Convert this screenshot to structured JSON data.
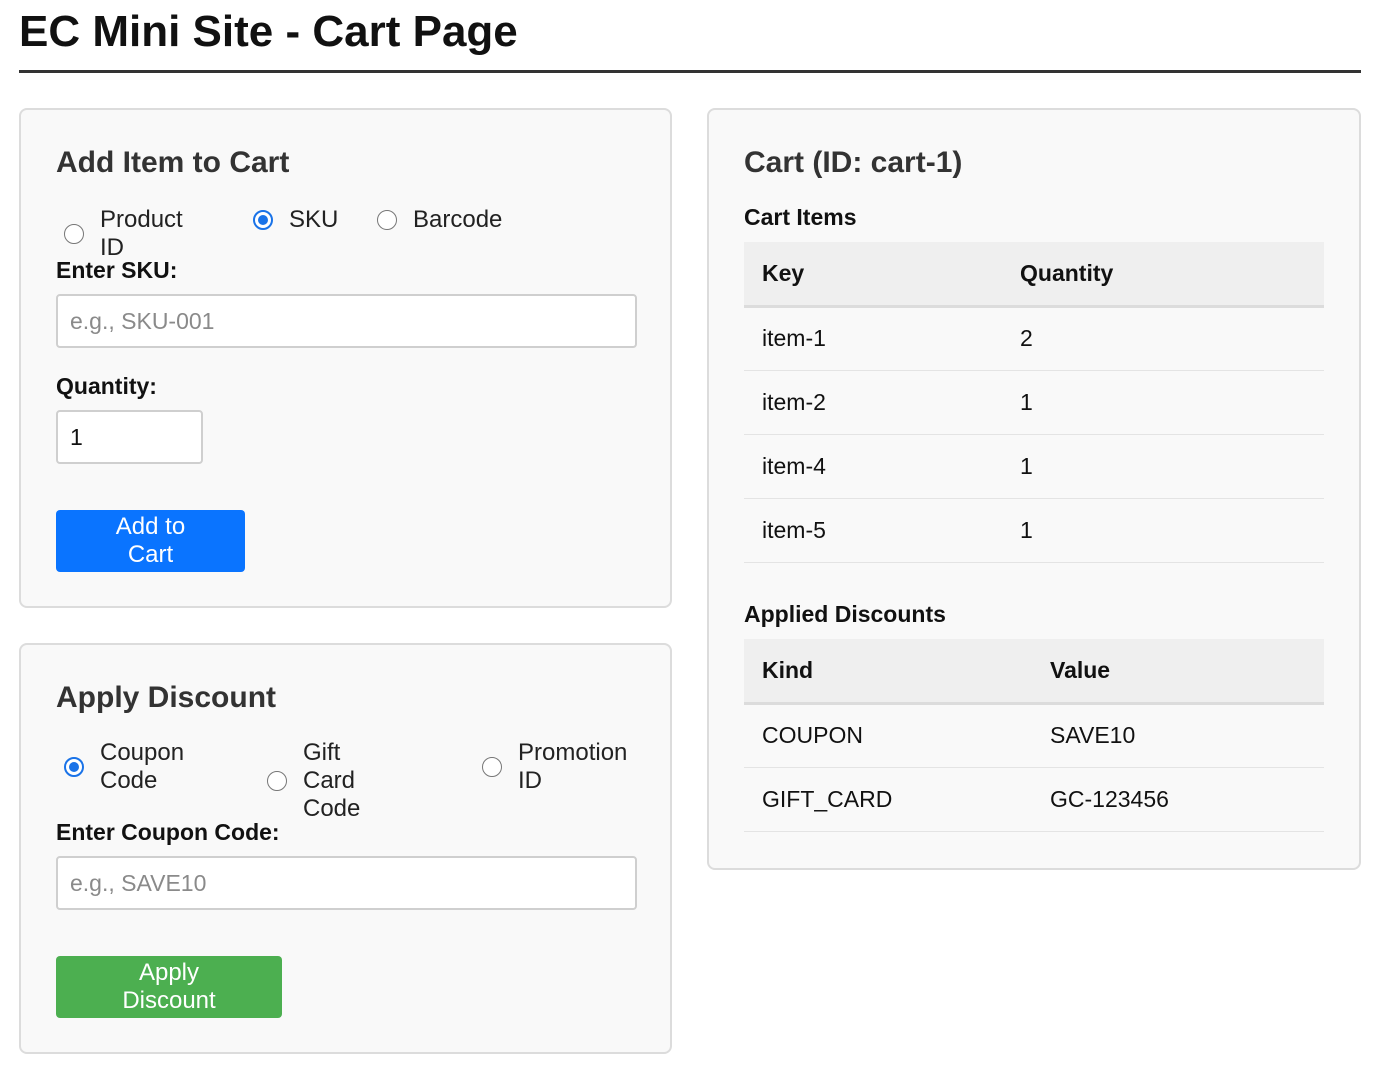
{
  "page": {
    "title": "EC Mini Site - Cart Page"
  },
  "add_item": {
    "heading": "Add Item to Cart",
    "id_types": [
      {
        "label": "Product ID",
        "checked": false
      },
      {
        "label": "SKU",
        "checked": true
      },
      {
        "label": "Barcode",
        "checked": false
      }
    ],
    "sku_label": "Enter SKU:",
    "sku_placeholder": "e.g., SKU-001",
    "sku_value": "",
    "quantity_label": "Quantity:",
    "quantity_value": "1",
    "button_label": "Add to Cart"
  },
  "discount": {
    "heading": "Apply Discount",
    "types": [
      {
        "label_line1": "Coupon",
        "label_line2": "Code",
        "checked": true
      },
      {
        "label_line1": "Gift Card",
        "label_line2": "Code",
        "checked": false
      },
      {
        "label_line1": "Promotion",
        "label_line2": "ID",
        "checked": false
      }
    ],
    "code_label": "Enter Coupon Code:",
    "code_placeholder": "e.g., SAVE10",
    "code_value": "",
    "button_label": "Apply Discount"
  },
  "cart": {
    "heading": "Cart (ID: cart-1)",
    "items_heading": "Cart Items",
    "items_columns": [
      "Key",
      "Quantity"
    ],
    "items": [
      {
        "key": "item-1",
        "quantity": "2"
      },
      {
        "key": "item-2",
        "quantity": "1"
      },
      {
        "key": "item-4",
        "quantity": "1"
      },
      {
        "key": "item-5",
        "quantity": "1"
      }
    ],
    "discounts_heading": "Applied Discounts",
    "discounts_columns": [
      "Kind",
      "Value"
    ],
    "discounts": [
      {
        "kind": "COUPON",
        "value": "SAVE10"
      },
      {
        "kind": "GIFT_CARD",
        "value": "GC-123456"
      }
    ]
  },
  "colors": {
    "primary_button": "#0a74ff",
    "success_button": "#4caf50",
    "radio_accent": "#1a73e8"
  }
}
